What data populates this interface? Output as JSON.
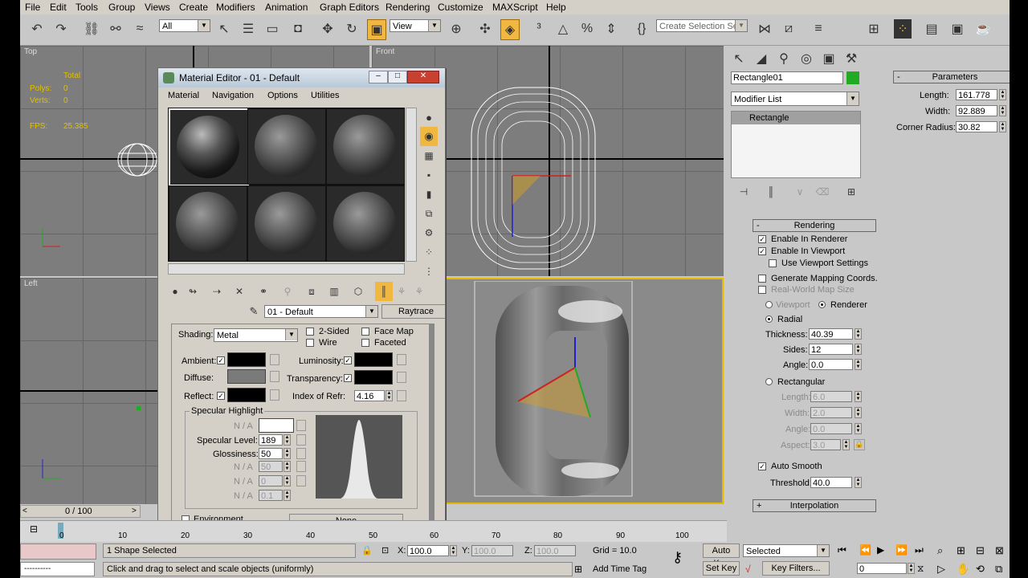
{
  "menu": [
    "File",
    "Edit",
    "Tools",
    "Group",
    "Views",
    "Create",
    "Modifiers",
    "Animation",
    "Graph Editors",
    "Rendering",
    "Customize",
    "MAXScript",
    "Help"
  ],
  "toolbar": {
    "filter_select": "All",
    "ref_coord_select": "View",
    "selection_set_placeholder": "Create Selection Se"
  },
  "viewports": {
    "top": {
      "label": "Top",
      "stats": {
        "total": "Total",
        "polys_label": "Polys:",
        "polys": "0",
        "verts_label": "Verts:",
        "verts": "0",
        "fps_label": "FPS:",
        "fps": "25.385"
      }
    },
    "front": {
      "label": "Front"
    },
    "left": {
      "label": "Left"
    },
    "perspective": {
      "label": ""
    }
  },
  "material_editor": {
    "title": "Material Editor - 01 - Default",
    "menu": [
      "Material",
      "Navigation",
      "Options",
      "Utilities"
    ],
    "material_name": "01 - Default",
    "type_button": "Raytrace",
    "shading_label": "Shading:",
    "shading_value": "Metal",
    "two_sided": "2-Sided",
    "wire": "Wire",
    "face_map": "Face Map",
    "faceted": "Faceted",
    "ambient": "Ambient:",
    "diffuse": "Diffuse:",
    "reflect": "Reflect:",
    "luminosity": "Luminosity:",
    "transparency": "Transparency:",
    "ior_label": "Index of Refr:",
    "ior_value": "4.16",
    "specular_group": "Specular Highlight",
    "na": "N / A",
    "spec_level_label": "Specular Level:",
    "spec_level": "189",
    "glossiness_label": "Glossiness:",
    "glossiness": "50",
    "na_values": [
      "50",
      "0",
      "0.1"
    ],
    "environment_label": "Environment",
    "environment_button": "None"
  },
  "command_panel": {
    "object_name": "Rectangle01",
    "object_color": "#22aa22",
    "modifier_list": "Modifier List",
    "stack": [
      "Rectangle"
    ],
    "parameters": {
      "title": "Parameters",
      "length_label": "Length:",
      "length": "161.778",
      "width_label": "Width:",
      "width": "92.889",
      "corner_label": "Corner Radius:",
      "corner": "30.82"
    },
    "rendering": {
      "title": "Rendering",
      "enable_renderer": "Enable In Renderer",
      "enable_viewport": "Enable In Viewport",
      "use_viewport_settings": "Use Viewport Settings",
      "gen_mapping": "Generate Mapping Coords.",
      "real_world": "Real-World Map Size",
      "viewport_radio": "Viewport",
      "renderer_radio": "Renderer",
      "radial": "Radial",
      "thickness_label": "Thickness:",
      "thickness": "40.39",
      "sides_label": "Sides:",
      "sides": "12",
      "angle_label": "Angle:",
      "angle": "0.0",
      "rectangular": "Rectangular",
      "r_length_label": "Length:",
      "r_length": "6.0",
      "r_width_label": "Width:",
      "r_width": "2.0",
      "r_angle_label": "Angle:",
      "r_angle": "0.0",
      "aspect_label": "Aspect:",
      "aspect": "3.0",
      "auto_smooth": "Auto Smooth",
      "threshold_label": "Threshold:",
      "threshold": "40.0"
    },
    "interpolation": "Interpolation"
  },
  "timeline": {
    "frame": "0 / 100",
    "ticks": [
      "0",
      "10",
      "20",
      "30",
      "40",
      "50",
      "60",
      "70",
      "80",
      "90",
      "100"
    ]
  },
  "status": {
    "selection": "1 Shape Selected",
    "prompt": "Click and drag to select and scale objects (uniformly)",
    "x_label": "X:",
    "x": "100.0",
    "y_label": "Y:",
    "y": "100.0",
    "z_label": "Z:",
    "z": "100.0",
    "grid": "Grid = 10.0",
    "add_time_tag": "Add Time Tag",
    "auto_key": "Auto Key",
    "set_key": "Set Key",
    "selected": "Selected",
    "key_filters": "Key Filters...",
    "frame_field": "0",
    "maxscript_dashes": "----------"
  }
}
